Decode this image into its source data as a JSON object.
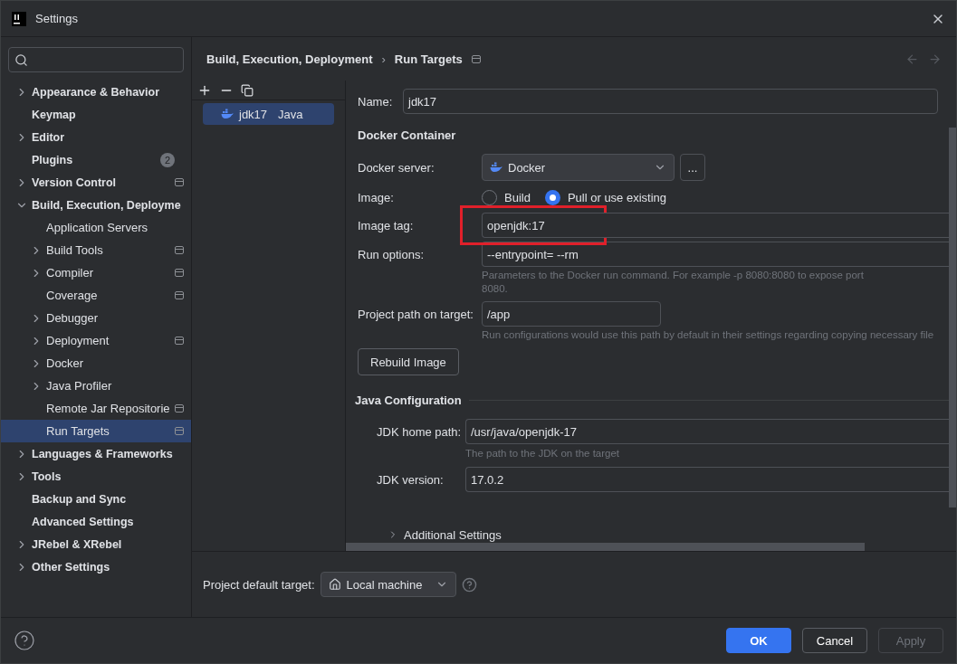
{
  "window": {
    "title": "Settings"
  },
  "sidebar": {
    "items": [
      {
        "label": "Appearance & Behavior",
        "expandable": true,
        "expanded": false,
        "selected": false
      },
      {
        "label": "Keymap",
        "expandable": false,
        "selected": false
      },
      {
        "label": "Editor",
        "expandable": true,
        "expanded": false,
        "selected": false
      },
      {
        "label": "Plugins",
        "expandable": false,
        "selected": false,
        "badge": "2"
      },
      {
        "label": "Version Control",
        "expandable": true,
        "expanded": false,
        "selected": false,
        "project_scope": true
      },
      {
        "label": "Build, Execution, Deployme",
        "expandable": true,
        "expanded": true,
        "selected": false,
        "children": [
          {
            "label": "Application Servers",
            "expandable": false,
            "selected": false
          },
          {
            "label": "Build Tools",
            "expandable": true,
            "expanded": false,
            "selected": false,
            "project_scope": true
          },
          {
            "label": "Compiler",
            "expandable": true,
            "expanded": false,
            "selected": false,
            "project_scope": true
          },
          {
            "label": "Coverage",
            "expandable": false,
            "selected": false,
            "project_scope": true
          },
          {
            "label": "Debugger",
            "expandable": true,
            "expanded": false,
            "selected": false
          },
          {
            "label": "Deployment",
            "expandable": true,
            "expanded": false,
            "selected": false,
            "project_scope": true
          },
          {
            "label": "Docker",
            "expandable": true,
            "expanded": false,
            "selected": false
          },
          {
            "label": "Java Profiler",
            "expandable": true,
            "expanded": false,
            "selected": false
          },
          {
            "label": "Remote Jar Repositorie",
            "expandable": false,
            "selected": false,
            "project_scope": true
          },
          {
            "label": "Run Targets",
            "expandable": false,
            "selected": true,
            "project_scope": true
          }
        ]
      },
      {
        "label": "Languages & Frameworks",
        "expandable": true,
        "expanded": false,
        "selected": false
      },
      {
        "label": "Tools",
        "expandable": true,
        "expanded": false,
        "selected": false
      },
      {
        "label": "Backup and Sync",
        "expandable": false,
        "selected": false
      },
      {
        "label": "Advanced Settings",
        "expandable": false,
        "selected": false
      },
      {
        "label": "JRebel & XRebel",
        "expandable": true,
        "expanded": false,
        "selected": false
      },
      {
        "label": "Other Settings",
        "expandable": true,
        "expanded": false,
        "selected": false
      }
    ]
  },
  "breadcrumb": {
    "items": [
      "Build, Execution, Deployment",
      "Run Targets"
    ],
    "separator": "›",
    "project_scope": true
  },
  "targets": {
    "items": [
      {
        "name": "jdk17",
        "type": "Java",
        "selected": true
      }
    ]
  },
  "form": {
    "name": {
      "label": "Name:",
      "value": "jdk17"
    },
    "sections": [
      {
        "title": "Docker Container",
        "indent": false,
        "rows": [
          {
            "kind": "select",
            "label": "Docker server:",
            "value": "Docker",
            "extra_button": "..."
          },
          {
            "kind": "radio",
            "label": "Image:",
            "options": [
              {
                "label": "Build",
                "selected": false
              },
              {
                "label": "Pull or use existing",
                "selected": true
              }
            ]
          },
          {
            "kind": "text",
            "label": "Image tag:",
            "value": "openjdk:17",
            "highlighted": true
          },
          {
            "kind": "text",
            "label": "Run options:",
            "value": "--entrypoint= --rm",
            "hint": "Parameters to the Docker run command. For example -p 8080:8080 to expose port 8080."
          },
          {
            "kind": "short_text",
            "label": "Project path on target:",
            "value": "/app",
            "hint": "Run configurations would use this path by default in their settings regarding copying necessary file"
          },
          {
            "kind": "button",
            "label": "Rebuild Image"
          }
        ]
      },
      {
        "title": "Java Configuration",
        "indent": true,
        "rows": [
          {
            "kind": "text",
            "label": "JDK home path:",
            "value": "/usr/java/openjdk-17",
            "hint": "The path to the JDK on the target"
          },
          {
            "kind": "text",
            "label": "JDK version:",
            "value": "17.0.2"
          }
        ]
      }
    ],
    "additional": {
      "label": "Additional Settings",
      "expanded": false
    }
  },
  "default_target": {
    "label": "Project default target:",
    "value": "Local machine"
  },
  "buttons": [
    {
      "label": "OK",
      "primary": true,
      "disabled": false
    },
    {
      "label": "Cancel",
      "primary": false,
      "disabled": false
    },
    {
      "label": "Apply",
      "primary": false,
      "disabled": true
    }
  ]
}
